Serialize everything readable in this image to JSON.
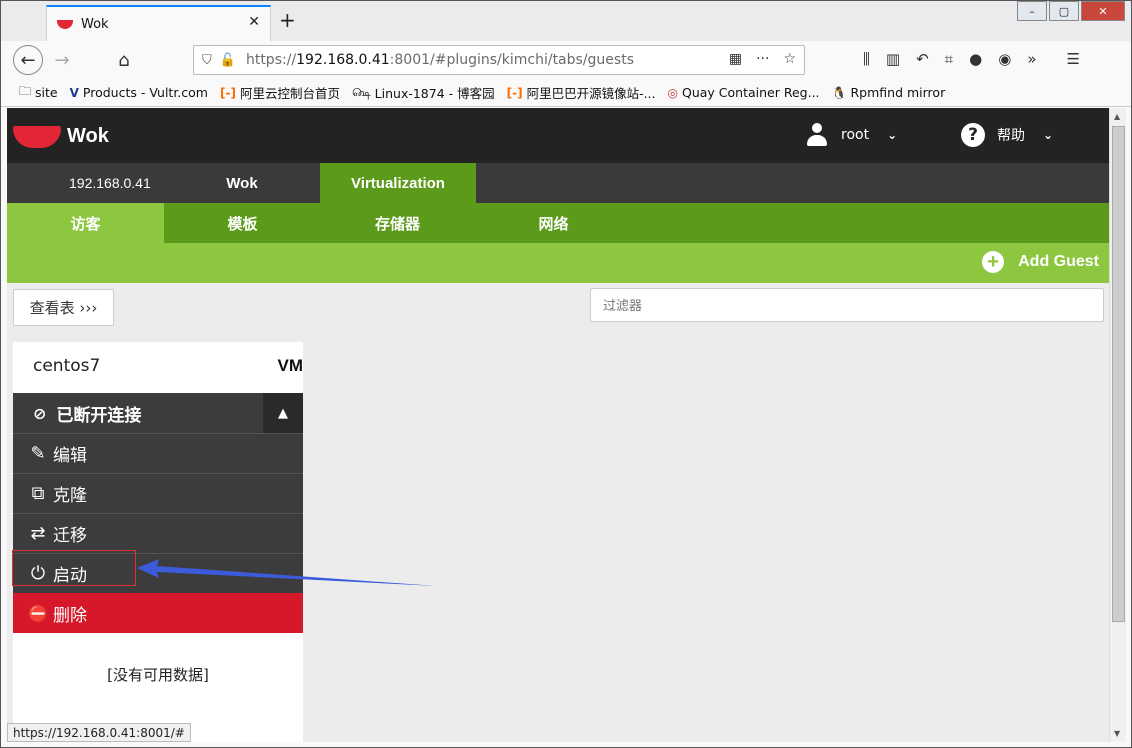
{
  "browser": {
    "tab_title": "Wok",
    "url_prefix": "https://",
    "url_host": "192.168.0.41",
    "url_rest": ":8001/#plugins/kimchi/tabs/guests",
    "status_url": "https://192.168.0.41:8001/#"
  },
  "bookmarks": [
    {
      "icon": "folder-icon",
      "label": "site"
    },
    {
      "icon": "vultr-icon",
      "label": "Products - Vultr.com"
    },
    {
      "icon": "aliyun-icon",
      "label": "阿里云控制台首页"
    },
    {
      "icon": "linux-icon",
      "label": "Linux-1874 - 博客园"
    },
    {
      "icon": "aliyun-icon",
      "label": "阿里巴巴开源镜像站-..."
    },
    {
      "icon": "quay-icon",
      "label": "Quay Container Reg..."
    },
    {
      "icon": "tux-icon",
      "label": "Rpmfind mirror"
    }
  ],
  "header": {
    "logo_text": "Wok",
    "user": "root",
    "help": "帮助"
  },
  "host_tabs": {
    "host": "192.168.0.41",
    "wok": "Wok",
    "virtualization": "Virtualization"
  },
  "sub_tabs": [
    "访客",
    "模板",
    "存储器",
    "网络"
  ],
  "actions": {
    "add_guest": "Add Guest",
    "view_toggle": "查看表 ›››",
    "filter_placeholder": "过滤器"
  },
  "guest": {
    "name": "centos7",
    "type": "VM",
    "state": "已断开连接",
    "menu": {
      "edit": "编辑",
      "clone": "克隆",
      "migrate": "迁移",
      "start": "启动",
      "delete": "删除"
    }
  },
  "empty_message": "[没有可用数据]",
  "colors": {
    "topbar": "#232323",
    "accent_green": "#5b9a1a",
    "light_green": "#8dc63f",
    "danger_red": "#d7182a",
    "annotation_blue": "#3b5bdb"
  }
}
